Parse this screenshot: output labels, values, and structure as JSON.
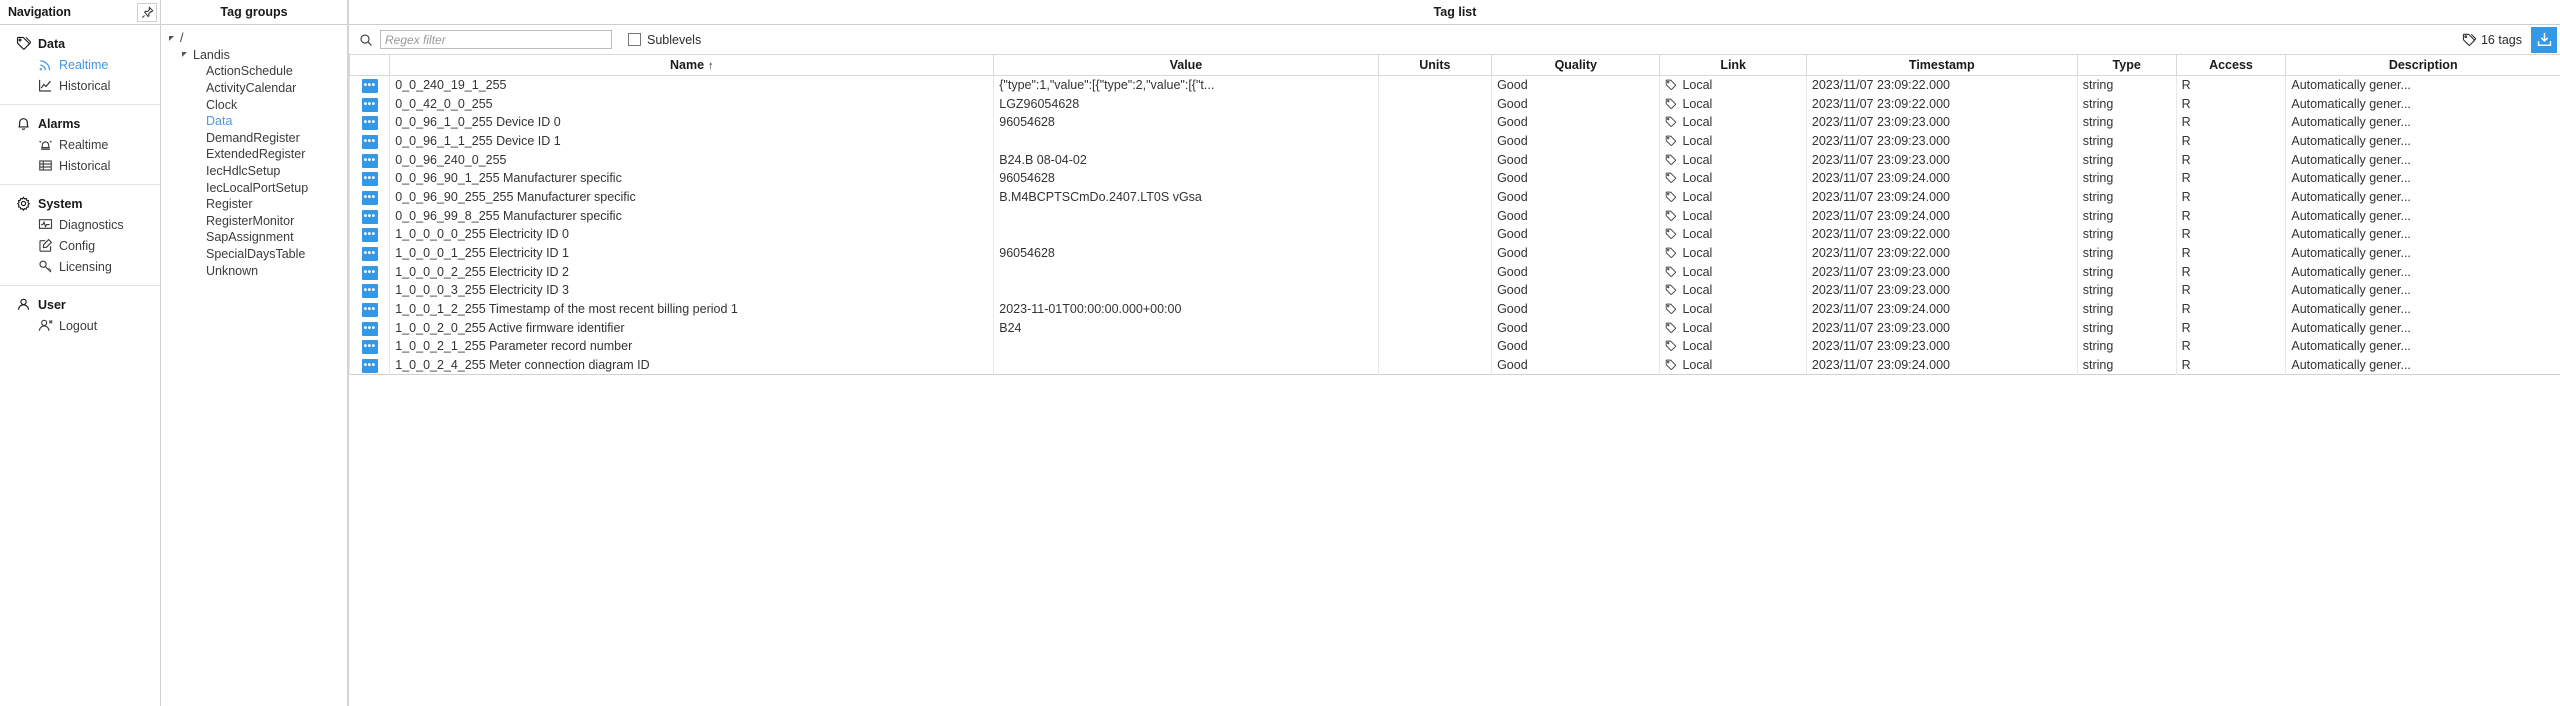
{
  "navigation": {
    "title": "Navigation",
    "pin_icon": "pin-icon",
    "sections": [
      {
        "group_label": "Data",
        "group_icon": "tag-icon",
        "items": [
          {
            "label": "Realtime",
            "icon": "rss-icon",
            "active": true
          },
          {
            "label": "Historical",
            "icon": "chart-line-icon",
            "active": false
          }
        ]
      },
      {
        "group_label": "Alarms",
        "group_icon": "bell-icon",
        "items": [
          {
            "label": "Realtime",
            "icon": "siren-icon",
            "active": false
          },
          {
            "label": "Historical",
            "icon": "table-icon",
            "active": false
          }
        ]
      },
      {
        "group_label": "System",
        "group_icon": "gear-icon",
        "items": [
          {
            "label": "Diagnostics",
            "icon": "monitor-pulse-icon",
            "active": false
          },
          {
            "label": "Config",
            "icon": "edit-square-icon",
            "active": false
          },
          {
            "label": "Licensing",
            "icon": "key-icon",
            "active": false
          }
        ]
      },
      {
        "group_label": "User",
        "group_icon": "user-icon",
        "items": [
          {
            "label": "Logout",
            "icon": "user-logout-icon",
            "active": false
          }
        ]
      }
    ]
  },
  "tag_groups": {
    "title": "Tag groups",
    "tree": [
      {
        "label": "/",
        "depth": 0,
        "expandable": true,
        "selected": false
      },
      {
        "label": "Landis",
        "depth": 1,
        "expandable": true,
        "selected": false
      },
      {
        "label": "ActionSchedule",
        "depth": 2,
        "expandable": false,
        "selected": false
      },
      {
        "label": "ActivityCalendar",
        "depth": 2,
        "expandable": false,
        "selected": false
      },
      {
        "label": "Clock",
        "depth": 2,
        "expandable": false,
        "selected": false
      },
      {
        "label": "Data",
        "depth": 2,
        "expandable": false,
        "selected": true
      },
      {
        "label": "DemandRegister",
        "depth": 2,
        "expandable": false,
        "selected": false
      },
      {
        "label": "ExtendedRegister",
        "depth": 2,
        "expandable": false,
        "selected": false
      },
      {
        "label": "IecHdlcSetup",
        "depth": 2,
        "expandable": false,
        "selected": false
      },
      {
        "label": "IecLocalPortSetup",
        "depth": 2,
        "expandable": false,
        "selected": false
      },
      {
        "label": "Register",
        "depth": 2,
        "expandable": false,
        "selected": false
      },
      {
        "label": "RegisterMonitor",
        "depth": 2,
        "expandable": false,
        "selected": false
      },
      {
        "label": "SapAssignment",
        "depth": 2,
        "expandable": false,
        "selected": false
      },
      {
        "label": "SpecialDaysTable",
        "depth": 2,
        "expandable": false,
        "selected": false
      },
      {
        "label": "Unknown",
        "depth": 2,
        "expandable": false,
        "selected": false
      }
    ]
  },
  "tag_list": {
    "title": "Tag list",
    "toolbar": {
      "search_icon": "search-icon",
      "search_value": "",
      "search_placeholder": "Regex filter",
      "sublevels_label": "Sublevels",
      "sublevels_checked": false,
      "tag_count_icon": "tag-icon",
      "tag_count_label": "16 tags",
      "download_icon": "download-icon"
    },
    "columns": [
      {
        "key": "action",
        "label": ""
      },
      {
        "key": "name",
        "label": "Name",
        "sorted": "asc",
        "sort_glyph": "↑"
      },
      {
        "key": "value",
        "label": "Value"
      },
      {
        "key": "units",
        "label": "Units"
      },
      {
        "key": "quality",
        "label": "Quality"
      },
      {
        "key": "link",
        "label": "Link"
      },
      {
        "key": "timestamp",
        "label": "Timestamp"
      },
      {
        "key": "type",
        "label": "Type"
      },
      {
        "key": "access",
        "label": "Access"
      },
      {
        "key": "description",
        "label": "Description"
      }
    ],
    "action_label": "•••",
    "rows": [
      {
        "name": "0_0_240_19_1_255",
        "value": "{\"type\":1,\"value\":[{\"type\":2,\"value\":[{\"t...",
        "units": "",
        "quality": "Good",
        "link": "Local",
        "timestamp": "2023/11/07 23:09:22.000",
        "type": "string",
        "access": "R",
        "description": "Automatically gener..."
      },
      {
        "name": "0_0_42_0_0_255",
        "value": "LGZ96054628",
        "units": "",
        "quality": "Good",
        "link": "Local",
        "timestamp": "2023/11/07 23:09:22.000",
        "type": "string",
        "access": "R",
        "description": "Automatically gener..."
      },
      {
        "name": "0_0_96_1_0_255 Device ID 0",
        "value": "96054628",
        "units": "",
        "quality": "Good",
        "link": "Local",
        "timestamp": "2023/11/07 23:09:23.000",
        "type": "string",
        "access": "R",
        "description": "Automatically gener..."
      },
      {
        "name": "0_0_96_1_1_255 Device ID 1",
        "value": "",
        "units": "",
        "quality": "Good",
        "link": "Local",
        "timestamp": "2023/11/07 23:09:23.000",
        "type": "string",
        "access": "R",
        "description": "Automatically gener..."
      },
      {
        "name": "0_0_96_240_0_255",
        "value": "B24.B 08-04-02",
        "units": "",
        "quality": "Good",
        "link": "Local",
        "timestamp": "2023/11/07 23:09:23.000",
        "type": "string",
        "access": "R",
        "description": "Automatically gener..."
      },
      {
        "name": "0_0_96_90_1_255 Manufacturer specific",
        "value": "96054628",
        "units": "",
        "quality": "Good",
        "link": "Local",
        "timestamp": "2023/11/07 23:09:24.000",
        "type": "string",
        "access": "R",
        "description": "Automatically gener..."
      },
      {
        "name": "0_0_96_90_255_255 Manufacturer specific",
        "value": "B.M4BCPTSCmDo.2407.LT0S vGsa",
        "units": "",
        "quality": "Good",
        "link": "Local",
        "timestamp": "2023/11/07 23:09:24.000",
        "type": "string",
        "access": "R",
        "description": "Automatically gener..."
      },
      {
        "name": "0_0_96_99_8_255 Manufacturer specific",
        "value": "",
        "units": "",
        "quality": "Good",
        "link": "Local",
        "timestamp": "2023/11/07 23:09:24.000",
        "type": "string",
        "access": "R",
        "description": "Automatically gener..."
      },
      {
        "name": "1_0_0_0_0_255 Electricity ID 0",
        "value": "",
        "units": "",
        "quality": "Good",
        "link": "Local",
        "timestamp": "2023/11/07 23:09:22.000",
        "type": "string",
        "access": "R",
        "description": "Automatically gener..."
      },
      {
        "name": "1_0_0_0_1_255 Electricity ID 1",
        "value": "96054628",
        "units": "",
        "quality": "Good",
        "link": "Local",
        "timestamp": "2023/11/07 23:09:22.000",
        "type": "string",
        "access": "R",
        "description": "Automatically gener..."
      },
      {
        "name": "1_0_0_0_2_255 Electricity ID 2",
        "value": "",
        "units": "",
        "quality": "Good",
        "link": "Local",
        "timestamp": "2023/11/07 23:09:23.000",
        "type": "string",
        "access": "R",
        "description": "Automatically gener..."
      },
      {
        "name": "1_0_0_0_3_255 Electricity ID 3",
        "value": "",
        "units": "",
        "quality": "Good",
        "link": "Local",
        "timestamp": "2023/11/07 23:09:23.000",
        "type": "string",
        "access": "R",
        "description": "Automatically gener..."
      },
      {
        "name": "1_0_0_1_2_255 Timestamp of the most recent billing period 1",
        "value": "2023-11-01T00:00:00.000+00:00",
        "units": "",
        "quality": "Good",
        "link": "Local",
        "timestamp": "2023/11/07 23:09:24.000",
        "type": "string",
        "access": "R",
        "description": "Automatically gener..."
      },
      {
        "name": "1_0_0_2_0_255 Active firmware identifier",
        "value": "B24",
        "units": "",
        "quality": "Good",
        "link": "Local",
        "timestamp": "2023/11/07 23:09:23.000",
        "type": "string",
        "access": "R",
        "description": "Automatically gener..."
      },
      {
        "name": "1_0_0_2_1_255 Parameter record number",
        "value": "",
        "units": "",
        "quality": "Good",
        "link": "Local",
        "timestamp": "2023/11/07 23:09:23.000",
        "type": "string",
        "access": "R",
        "description": "Automatically gener..."
      },
      {
        "name": "1_0_0_2_4_255 Meter connection diagram ID",
        "value": "",
        "units": "",
        "quality": "Good",
        "link": "Local",
        "timestamp": "2023/11/07 23:09:24.000",
        "type": "string",
        "access": "R",
        "description": "Automatically gener..."
      }
    ]
  },
  "colors": {
    "accent": "#3399e6",
    "active_link": "#3e96de",
    "tree_selected": "#4a9ae0",
    "border": "#cfcfcf"
  }
}
